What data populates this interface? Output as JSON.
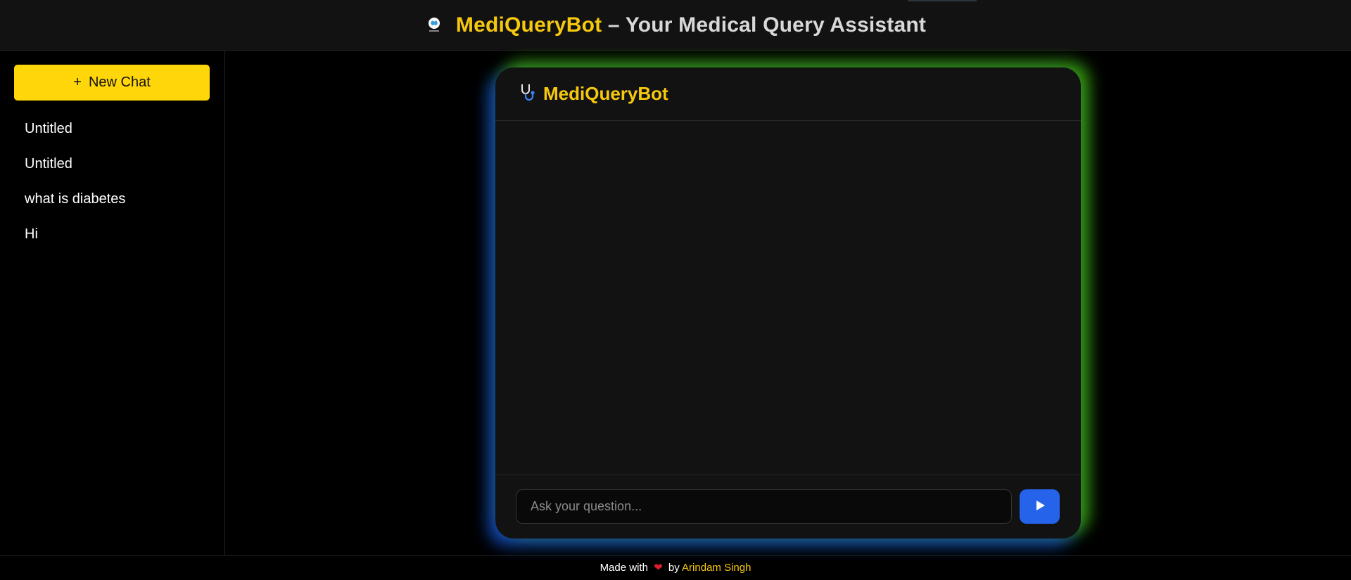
{
  "header": {
    "brand": "MediQueryBot",
    "title_rest": " – Your Medical Query Assistant",
    "logo_icon": "brain-medical-logo-icon"
  },
  "sidebar": {
    "new_chat_icon": "+",
    "new_chat_label": "New Chat",
    "history": [
      {
        "label": "Untitled"
      },
      {
        "label": "Untitled"
      },
      {
        "label": "what is diabetes"
      },
      {
        "label": "Hi"
      }
    ]
  },
  "chat": {
    "title": "MediQueryBot",
    "header_icon": "stethoscope-icon",
    "messages": [],
    "input_placeholder": "Ask your question...",
    "input_value": "",
    "send_icon": "play-triangle-icon"
  },
  "footer": {
    "made_with": "Made with",
    "heart": "❤",
    "by": "by",
    "author": "Arindam Singh"
  },
  "colors": {
    "accent_yellow": "#ffd60a",
    "brand_text": "#f6c90e",
    "send_button": "#2563eb",
    "glow_green": "#46c814",
    "glow_blue": "#1450e6",
    "heart": "#e11d2e"
  }
}
